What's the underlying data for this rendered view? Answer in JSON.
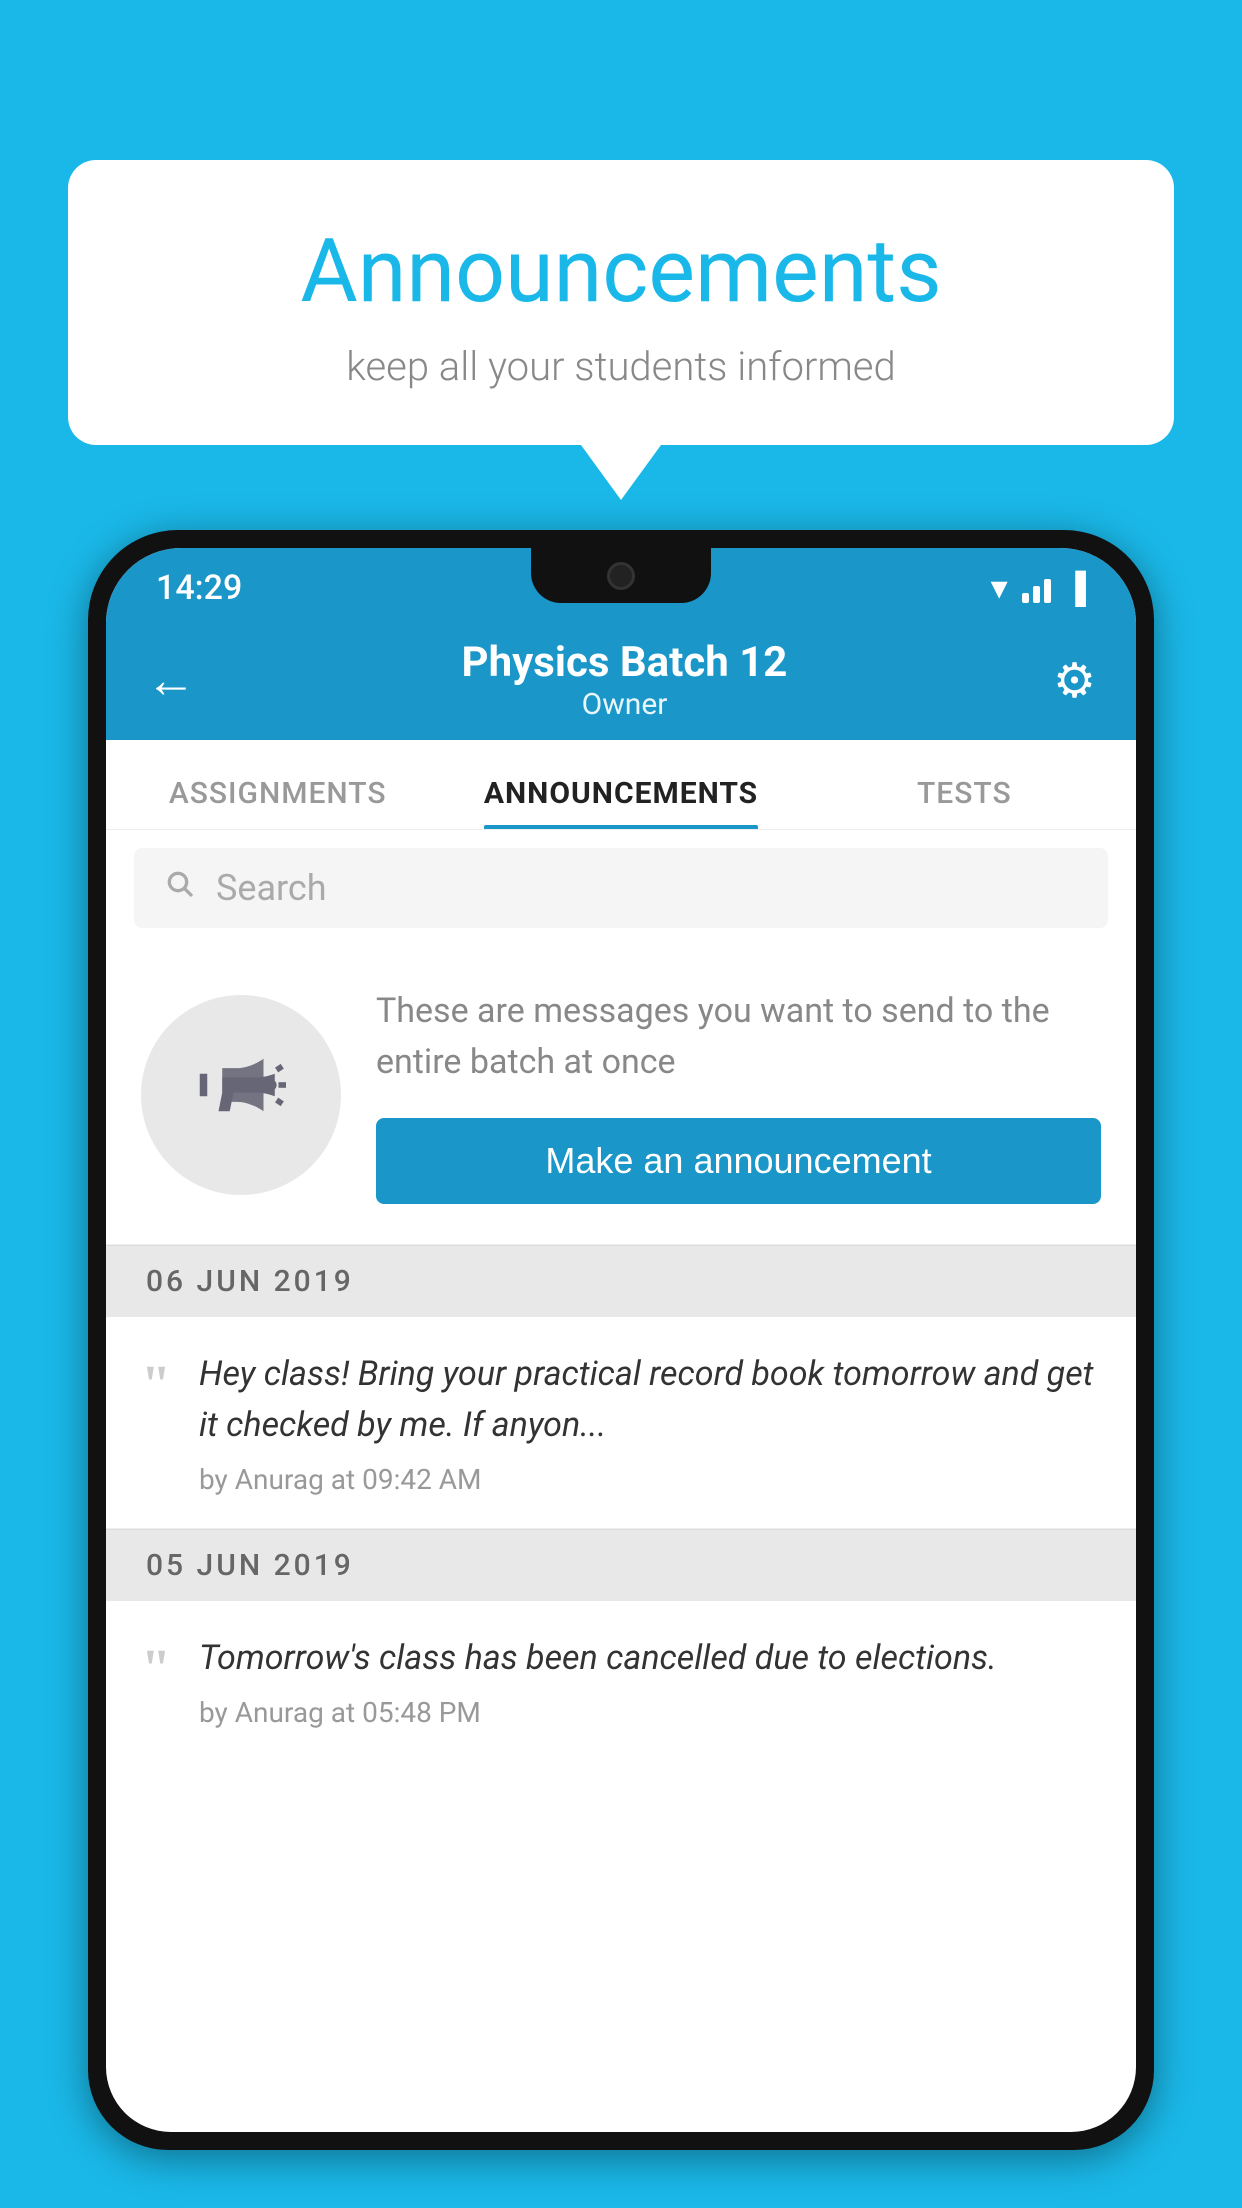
{
  "background_color": "#1ab8e8",
  "speech_bubble": {
    "title": "Announcements",
    "subtitle": "keep all your students informed"
  },
  "status_bar": {
    "time": "14:29"
  },
  "app_bar": {
    "title": "Physics Batch 12",
    "subtitle": "Owner",
    "back_label": "←",
    "settings_label": "⚙"
  },
  "tabs": [
    {
      "label": "ASSIGNMENTS",
      "active": false
    },
    {
      "label": "ANNOUNCEMENTS",
      "active": true
    },
    {
      "label": "TESTS",
      "active": false
    }
  ],
  "search": {
    "placeholder": "Search"
  },
  "empty_state": {
    "description": "These are messages you want to send to the entire batch at once",
    "button_label": "Make an announcement"
  },
  "messages": [
    {
      "date": "06  JUN  2019",
      "text": "Hey class! Bring your practical record book tomorrow and get it checked by me. If anyon...",
      "meta": "by Anurag at 09:42 AM"
    },
    {
      "date": "05  JUN  2019",
      "text": "Tomorrow's class has been cancelled due to elections.",
      "meta": "by Anurag at 05:48 PM"
    }
  ]
}
